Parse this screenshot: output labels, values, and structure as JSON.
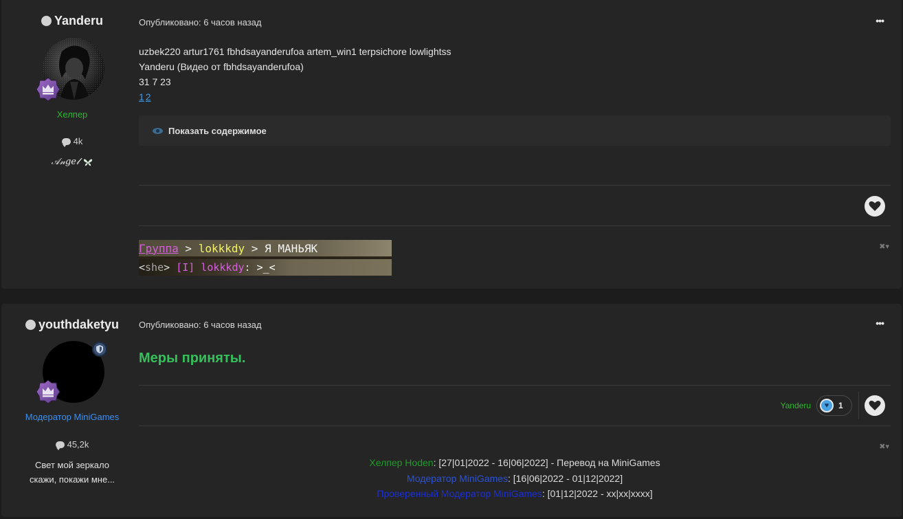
{
  "posts": [
    {
      "author": "Yanderu",
      "role": "Хелпер",
      "post_count": "4k",
      "custom_title": "𝒜𝓃𝑔𝑒𝓁",
      "posted": "Опубликовано: 6 часов назад",
      "menu": "•••",
      "content_lines": [
        "uzbek220 artur1761 fbhdsayanderufoa artem_win1 terpsichore lowlightss",
        "Yanderu (Видео от fbhdsayanderufoa)",
        "31 7 23"
      ],
      "links": [
        "1",
        "2"
      ],
      "spoiler_label": "Показать содержимое",
      "like_icon": "heart-icon",
      "signature": {
        "line1": [
          {
            "text": "Группа",
            "color": "#d65fe0"
          },
          {
            "text": " > ",
            "color": "#f0f0f0"
          },
          {
            "text": "lokkkdy",
            "color": "#f2f26b"
          },
          {
            "text": " > ",
            "color": "#f0f0f0"
          },
          {
            "text": "Я МАНЬЯК",
            "color": "#f5f5f5"
          }
        ],
        "line2": [
          {
            "text": "<",
            "color": "#dddddd"
          },
          {
            "text": "she",
            "color": "#a8a8a8"
          },
          {
            "text": "> ",
            "color": "#dddddd"
          },
          {
            "text": "[I] lokkkdy",
            "color": "#d65fe0"
          },
          {
            "text": ": ",
            "color": "#dddddd"
          },
          {
            "text": ">_<",
            "color": "#ffffff"
          }
        ]
      }
    },
    {
      "author": "youthdaketyu",
      "role": "Модератор MiniGames",
      "post_count": "45,2k",
      "bio": "Свет мой зеркало скажи, покажи мне...",
      "posted": "Опубликовано: 6 часов назад",
      "menu": "•••",
      "headline": "Меры приняты.",
      "reaction_user": "Yanderu",
      "reaction_count": "1",
      "history": [
        {
          "label": "Хелпер Hoden",
          "label_class": "h-green",
          "rest": ": [27|01|2022 - 16|06|2022] - Перевод на MiniGames"
        },
        {
          "label": "Модератор MiniGames",
          "label_class": "h-blue",
          "rest": ": [16|06|2022 - 01|12|2022]"
        },
        {
          "label": "Проверенный Модератор MiniGames",
          "label_class": "h-navy",
          "rest": ": [01|12|2022 - xx|xx|xxxx]"
        }
      ]
    }
  ],
  "colors": {
    "background": "#1c1c1c",
    "panel": "#252525",
    "helper_green": "#2fb734",
    "moderator_blue": "#3b8ff0",
    "headline_green": "#35c05c",
    "link_blue": "#3b9be8"
  }
}
